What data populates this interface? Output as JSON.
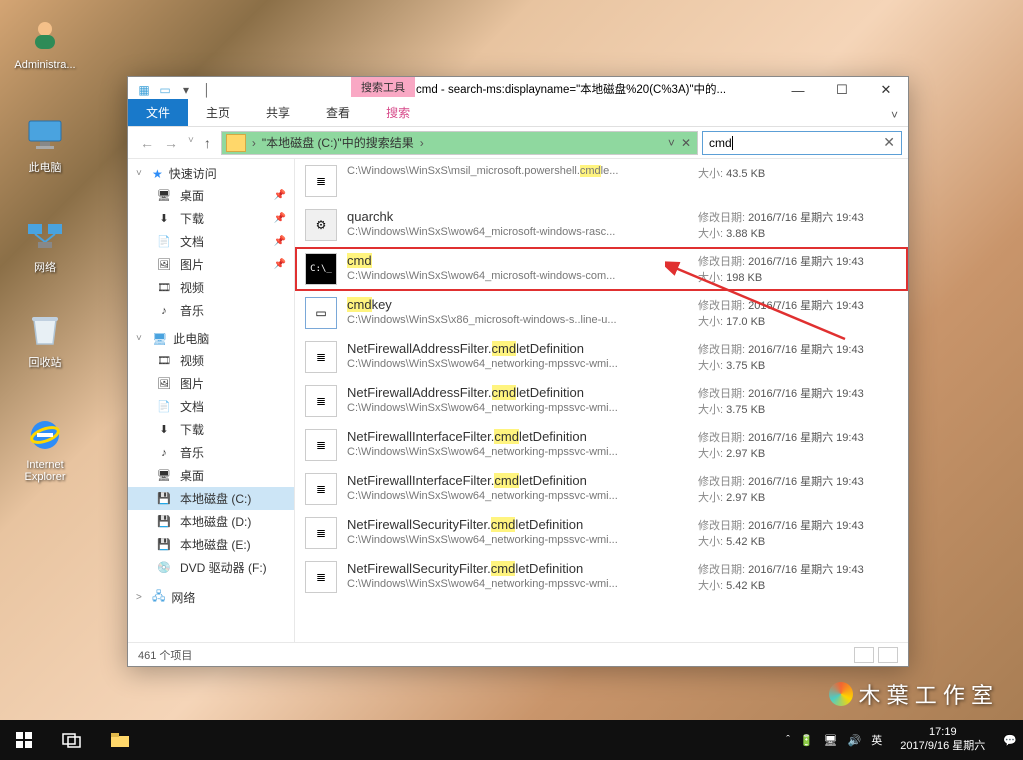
{
  "desktop": {
    "icons": {
      "admin": "Administra...",
      "pc": "此电脑",
      "network": "网络",
      "recycle": "回收站",
      "ie1": "Internet",
      "ie2": "Explorer"
    }
  },
  "watermark": "木 葉 工 作 室",
  "window": {
    "search_tool": "搜索工具",
    "title": "cmd - search-ms:displayname=\"本地磁盘%20(C%3A)\"中的...",
    "tabs": {
      "file": "文件",
      "home": "主页",
      "share": "共享",
      "view": "查看",
      "search": "搜索"
    },
    "address": {
      "chev1": "›",
      "crumb1": "\"本地磁盘 (C:)\"中的搜索结果",
      "chev2": "›"
    },
    "search_value": "cmd",
    "statusbar": "461 个项目"
  },
  "sidebar": {
    "quick": {
      "label": "快速访问",
      "items": [
        {
          "label": "桌面",
          "icon": "🖥",
          "pin": true
        },
        {
          "label": "下载",
          "icon": "⬇",
          "pin": true
        },
        {
          "label": "文档",
          "icon": "📄",
          "pin": true
        },
        {
          "label": "图片",
          "icon": "🖼",
          "pin": true
        },
        {
          "label": "视频",
          "icon": "🎞",
          "pin": false
        },
        {
          "label": "音乐",
          "icon": "♪",
          "pin": false
        }
      ]
    },
    "pc": {
      "label": "此电脑",
      "items": [
        {
          "label": "视频",
          "icon": "🎞"
        },
        {
          "label": "图片",
          "icon": "🖼"
        },
        {
          "label": "文档",
          "icon": "📄"
        },
        {
          "label": "下载",
          "icon": "⬇"
        },
        {
          "label": "音乐",
          "icon": "♪"
        },
        {
          "label": "桌面",
          "icon": "🖥"
        },
        {
          "label": "本地磁盘 (C:)",
          "icon": "💾",
          "selected": true
        },
        {
          "label": "本地磁盘 (D:)",
          "icon": "💾"
        },
        {
          "label": "本地磁盘 (E:)",
          "icon": "💾"
        },
        {
          "label": "DVD 驱动器 (F:)",
          "icon": "💿"
        }
      ]
    },
    "network": {
      "label": "网络"
    }
  },
  "labels": {
    "date": "修改日期: ",
    "size": "大小: "
  },
  "results": [
    {
      "name_pre": "C:\\Windows\\WinSxS\\msil_microsoft.powershell.",
      "hl": "cmd",
      "name_post": "le...",
      "path": "",
      "date": "",
      "size": "43.5 KB",
      "icon": "doc",
      "toprow": true
    },
    {
      "name_pre": "quarchk",
      "hl": "",
      "name_post": "",
      "path": "C:\\Windows\\WinSxS\\wow64_microsoft-windows-rasc...",
      "date": "2016/7/16 星期六 19:43",
      "size": "3.88 KB",
      "icon": "gear"
    },
    {
      "name_pre": "",
      "hl": "cmd",
      "name_post": "",
      "path": "C:\\Windows\\WinSxS\\wow64_microsoft-windows-com...",
      "date": "2016/7/16 星期六 19:43",
      "size": "198 KB",
      "icon": "cmd",
      "highlighted": true,
      "path_hl": false
    },
    {
      "name_pre": "",
      "hl": "cmd",
      "name_post": "key",
      "path": "C:\\Windows\\WinSxS\\x86_microsoft-windows-s..line-u...",
      "date": "2016/7/16 星期六 19:43",
      "size": "17.0 KB",
      "icon": "app"
    },
    {
      "name_pre": "NetFirewallAddressFilter.",
      "hl": "cmd",
      "name_post": "letDefinition",
      "path": "C:\\Windows\\WinSxS\\wow64_networking-mpssvc-wmi...",
      "date": "2016/7/16 星期六 19:43",
      "size": "3.75 KB",
      "icon": "doc"
    },
    {
      "name_pre": "NetFirewallAddressFilter.",
      "hl": "cmd",
      "name_post": "letDefinition",
      "path": "C:\\Windows\\WinSxS\\wow64_networking-mpssvc-wmi...",
      "date": "2016/7/16 星期六 19:43",
      "size": "3.75 KB",
      "icon": "doc"
    },
    {
      "name_pre": "NetFirewallInterfaceFilter.",
      "hl": "cmd",
      "name_post": "letDefinition",
      "path": "C:\\Windows\\WinSxS\\wow64_networking-mpssvc-wmi...",
      "date": "2016/7/16 星期六 19:43",
      "size": "2.97 KB",
      "icon": "doc"
    },
    {
      "name_pre": "NetFirewallInterfaceFilter.",
      "hl": "cmd",
      "name_post": "letDefinition",
      "path": "C:\\Windows\\WinSxS\\wow64_networking-mpssvc-wmi...",
      "date": "2016/7/16 星期六 19:43",
      "size": "2.97 KB",
      "icon": "doc"
    },
    {
      "name_pre": "NetFirewallSecurityFilter.",
      "hl": "cmd",
      "name_post": "letDefinition",
      "path": "C:\\Windows\\WinSxS\\wow64_networking-mpssvc-wmi...",
      "date": "2016/7/16 星期六 19:43",
      "size": "5.42 KB",
      "icon": "doc"
    },
    {
      "name_pre": "NetFirewallSecurityFilter.",
      "hl": "cmd",
      "name_post": "letDefinition",
      "path": "C:\\Windows\\WinSxS\\wow64_networking-mpssvc-wmi...",
      "date": "2016/7/16 星期六 19:43",
      "size": "5.42 KB",
      "icon": "doc"
    }
  ],
  "taskbar": {
    "ime": "英",
    "time": "17:19",
    "date": "2017/9/16 星期六"
  }
}
